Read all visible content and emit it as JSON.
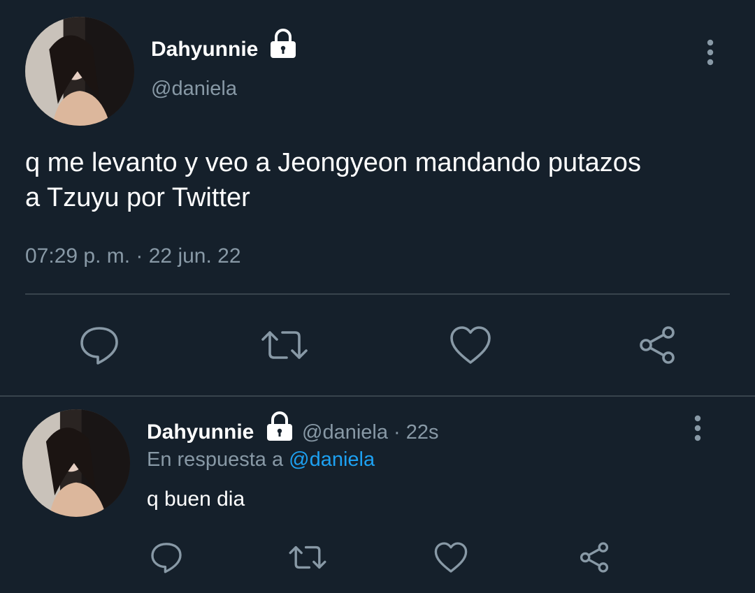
{
  "main_tweet": {
    "display_name": "Dahyunnie",
    "handle": "@daniela",
    "text_line1": "q me levanto y veo a Jeongyeon mandando putazos",
    "text_line2": "a Tzuyu por Twitter",
    "timestamp": "07:29 p. m. · 22 jun. 22",
    "icons": [
      "lock-icon",
      "more-vertical-icon",
      "reply-icon",
      "retweet-icon",
      "like-icon",
      "share-icon"
    ]
  },
  "reply_tweet": {
    "display_name": "Dahyunnie",
    "handle_time": "@daniela · 22s",
    "replying_prefix": "En respuesta a",
    "replying_handle": "@daniela",
    "text": "q buen dia",
    "icons": [
      "lock-icon",
      "more-vertical-icon",
      "reply-icon",
      "retweet-icon",
      "like-icon",
      "share-icon"
    ]
  },
  "colors": {
    "background": "#15202b",
    "text": "#ffffff",
    "muted": "#8899a6",
    "link": "#1da1f2",
    "divider": "#38444d"
  }
}
